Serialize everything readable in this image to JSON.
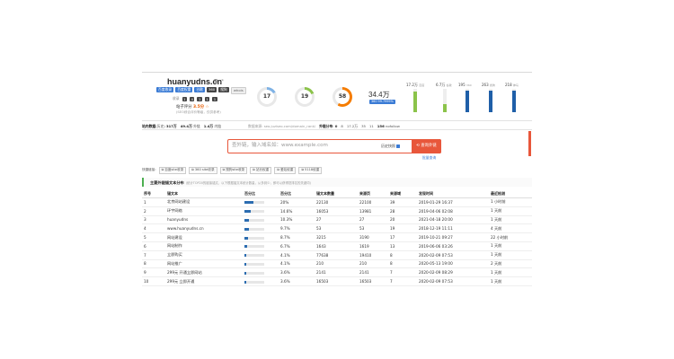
{
  "header": {
    "domain": "huanyudns.cn",
    "domain_icons": "⧉ ↗",
    "badges": [
      "百度收录",
      "百度权重",
      "谷歌",
      "360",
      "搜狗",
      "whois"
    ],
    "small_row": [
      "收录",
      "1",
      "4",
      "1",
      "1",
      "1"
    ],
    "score_label": "站子评分",
    "score_value": "3.5分",
    "score_suffix": "☆",
    "score_sub": "(SEO综合评价等级，仅供参考)"
  },
  "gauges": [
    {
      "value": "17",
      "color": "#7fb2e5",
      "percent": 17
    },
    {
      "value": "19",
      "color": "#8bc34a",
      "percent": 19
    },
    {
      "value": "58",
      "color": "#f57c00",
      "percent": 58
    }
  ],
  "highlight": {
    "value": "34.4万",
    "badge": "360 99.7999%"
  },
  "bars": [
    {
      "label": "17.2万",
      "sub": "百度",
      "percent": 90,
      "color": "#8bc34a"
    },
    {
      "label": "6.7万",
      "sub": "谷歌",
      "percent": 35,
      "color": "#8bc34a"
    },
    {
      "label": "195",
      "sub": "360",
      "percent": 92,
      "color": "#1f5fa8"
    },
    {
      "label": "263",
      "sub": "搜狗",
      "percent": 92,
      "color": "#1f5fa8"
    },
    {
      "label": "218",
      "sub": "神马",
      "percent": 92,
      "color": "#1f5fa8"
    }
  ],
  "stats": {
    "left": [
      {
        "label": "站内数据",
        "value": ""
      },
      {
        "label": "(历史)",
        "value": "317万"
      },
      {
        "label": "外链",
        "value": "49.4万"
      },
      {
        "label": "内链",
        "value": "1.4万"
      }
    ],
    "middle": "数据来源: seo.juziseo.com/domain_rank/",
    "right": [
      {
        "label": "外链分布",
        "value": "0"
      },
      {
        "label": "",
        "value": "8"
      },
      {
        "label": "",
        "value": "17.2万"
      },
      {
        "label": "",
        "value": "35"
      },
      {
        "label": "",
        "value": "11"
      },
      {
        "label": "",
        "value": "156"
      }
    ],
    "right_tail": "nofollow"
  },
  "search": {
    "placeholder": "查外链，输入域名如：www.example.com",
    "checkbox_label": "历史快照",
    "button_label": "⟲ 查询外链",
    "advanced_link": "批量查询"
  },
  "quick_label": "快捷链接:",
  "quick_links": [
    "⧉ 百度site收录",
    "⧉ 360 site收录",
    "⧉ 搜狗site收录",
    "⧉ 站长权重",
    "⧉ 爱站权重",
    "⧉ 5118权重"
  ],
  "section": {
    "title": "主要外链锚文本分布",
    "note": "(统计TOP20的链接锚文，以下根据锚文本统计数量，从多到少，即可以获得您排名的关键词)"
  },
  "table": {
    "headers": [
      "序号",
      "锚文本",
      "百分比",
      "百分比",
      "锚文本数量",
      "来源页",
      "来源域",
      "发现时间",
      "最近检测"
    ],
    "rows": [
      {
        "n": "1",
        "anchor": "北京网站建设",
        "pct": 20,
        "pct_text": "20%",
        "count": "22130",
        "pages": "22100",
        "domains": "39",
        "found": "2019-01-29 16:37",
        "checked": "1 小时前"
      },
      {
        "n": "2",
        "anchor": "环宇网络",
        "pct": 14.6,
        "pct_text": "14.6%",
        "count": "16053",
        "pages": "13981",
        "domains": "28",
        "found": "2019-04-06 02:08",
        "checked": "1 天前"
      },
      {
        "n": "3",
        "anchor": "huanyudns",
        "pct": 10.3,
        "pct_text": "10.3%",
        "count": "27",
        "pages": "27",
        "domains": "20",
        "found": "2021-04-18 20:00",
        "checked": "1 天前"
      },
      {
        "n": "4",
        "anchor": "www.huanyudns.cn",
        "pct": 9.7,
        "pct_text": "9.7%",
        "count": "53",
        "pages": "53",
        "domains": "19",
        "found": "2018-12-19 11:11",
        "checked": "4 天前"
      },
      {
        "n": "5",
        "anchor": "网站建设",
        "pct": 8.7,
        "pct_text": "8.7%",
        "count": "3215",
        "pages": "3190",
        "domains": "17",
        "found": "2019-10-21 09:27",
        "checked": "22 小时前"
      },
      {
        "n": "6",
        "anchor": "网站制作",
        "pct": 6.7,
        "pct_text": "6.7%",
        "count": "1643",
        "pages": "1619",
        "domains": "13",
        "found": "2019-06-06 03:26",
        "checked": "1 天前"
      },
      {
        "n": "7",
        "anchor": "立即购买",
        "pct": 4.1,
        "pct_text": "4.1%",
        "count": "77638",
        "pages": "19410",
        "domains": "8",
        "found": "2020-02-09 07:53",
        "checked": "1 天前"
      },
      {
        "n": "8",
        "anchor": "网站推广",
        "pct": 4.1,
        "pct_text": "4.1%",
        "count": "210",
        "pages": "210",
        "domains": "8",
        "found": "2020-05-13 19:00",
        "checked": "2 天前"
      },
      {
        "n": "9",
        "anchor": "299元 开通立即网站",
        "pct": 3.6,
        "pct_text": "3.6%",
        "count": "2141",
        "pages": "2141",
        "domains": "7",
        "found": "2020-02-09 08:29",
        "checked": "1 天前"
      },
      {
        "n": "10",
        "anchor": "299元 立即开通",
        "pct": 3.6,
        "pct_text": "3.6%",
        "count": "16503",
        "pages": "16503",
        "domains": "7",
        "found": "2020-02-09 07:53",
        "checked": "1 天前"
      }
    ]
  }
}
